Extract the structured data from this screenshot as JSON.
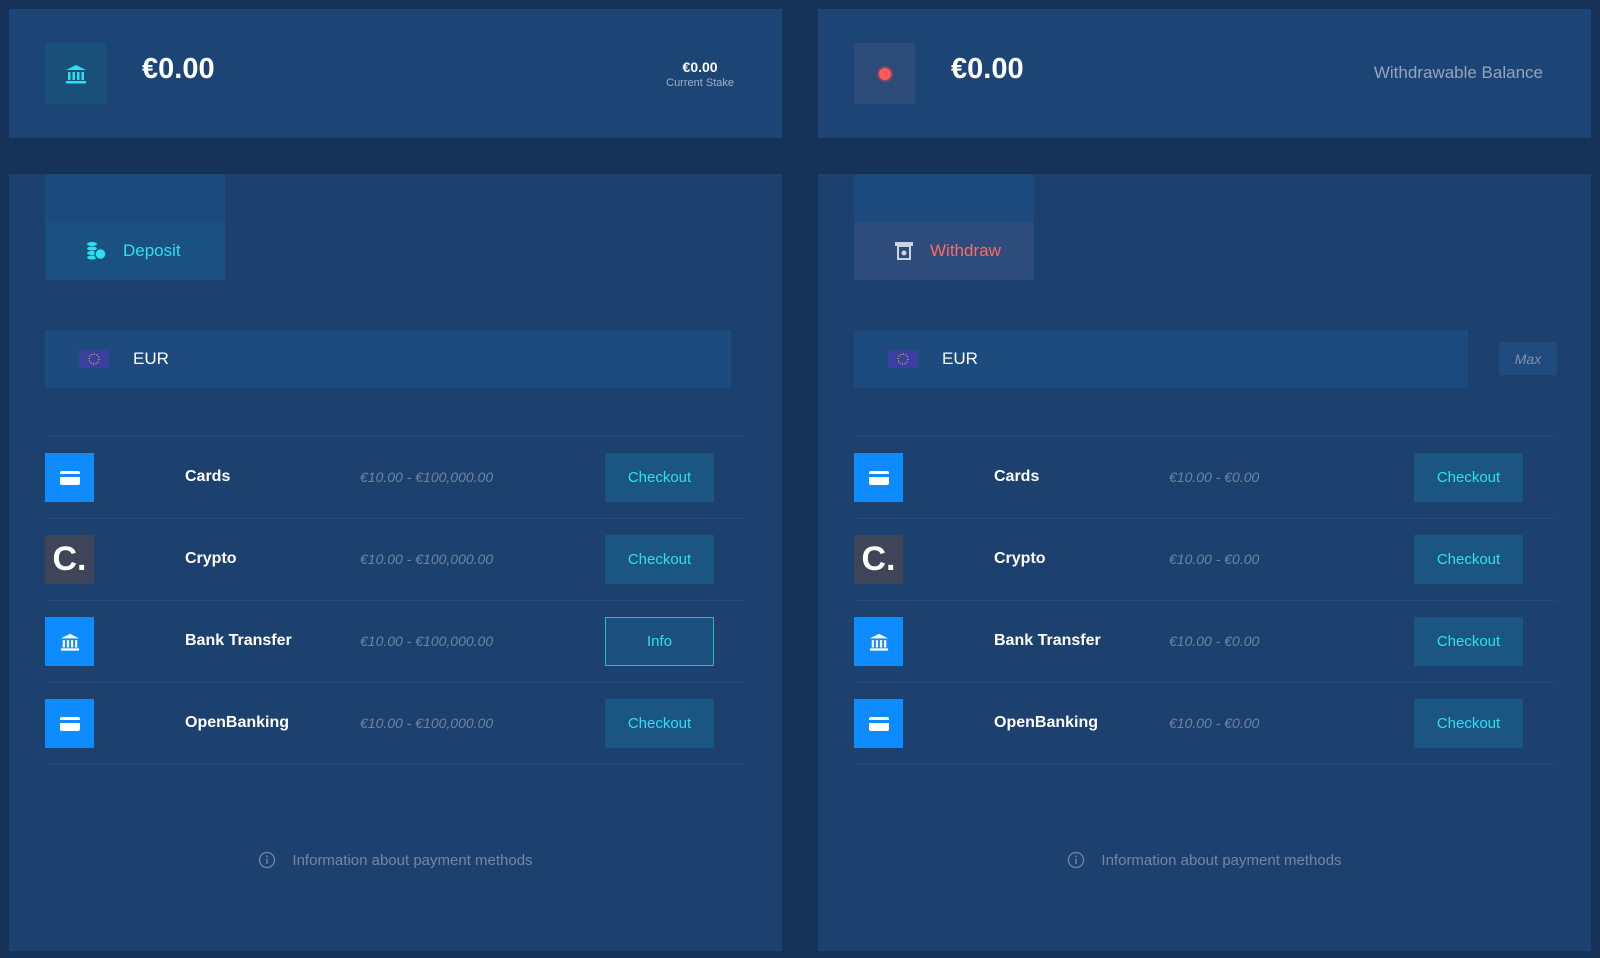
{
  "balance": {
    "amount": "€0.00",
    "stake_value": "€0.00",
    "stake_label": "Current Stake"
  },
  "withdrawable": {
    "amount": "€0.00",
    "label": "Withdrawable Balance"
  },
  "deposit": {
    "tab_label": "Deposit",
    "currency": "EUR",
    "methods": [
      {
        "name": "Cards",
        "range": "€10.00 - €100,000.00",
        "button": "Checkout"
      },
      {
        "name": "Crypto",
        "range": "€10.00 - €100,000.00",
        "button": "Checkout"
      },
      {
        "name": "Bank Transfer",
        "range": "€10.00 - €100,000.00",
        "button": "Info"
      },
      {
        "name": "OpenBanking",
        "range": "€10.00 - €100,000.00",
        "button": "Checkout"
      }
    ],
    "info_text": "Information about payment methods"
  },
  "withdraw": {
    "tab_label": "Withdraw",
    "currency": "EUR",
    "max_label": "Max",
    "methods": [
      {
        "name": "Cards",
        "range": "€10.00 - €0.00",
        "button": "Checkout"
      },
      {
        "name": "Crypto",
        "range": "€10.00 - €0.00",
        "button": "Checkout"
      },
      {
        "name": "Bank Transfer",
        "range": "€10.00 - €0.00",
        "button": "Checkout"
      },
      {
        "name": "OpenBanking",
        "range": "€10.00 - €0.00",
        "button": "Checkout"
      }
    ],
    "info_text": "Information about payment methods"
  },
  "crypto_glyph": "C.",
  "colors": {
    "background": "#173258",
    "card": "#1c4576",
    "accent": "#2de0f0",
    "withdraw_accent": "#ff6a60",
    "method_icon": "#0e8cff"
  }
}
